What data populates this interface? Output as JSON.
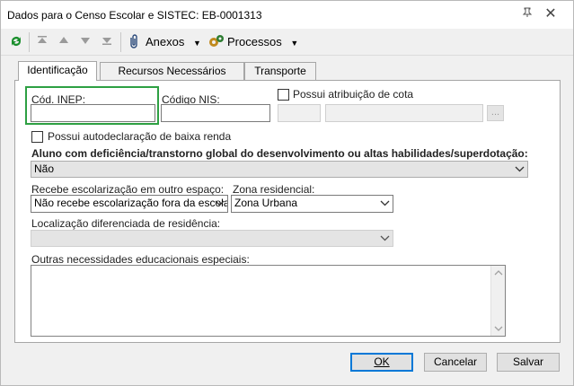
{
  "window": {
    "title": "Dados para o Censo Escolar e SISTEC: EB-0001313"
  },
  "toolbar": {
    "anexos": "Anexos",
    "processos": "Processos"
  },
  "tabs": [
    {
      "label": "Identificação"
    },
    {
      "label": "Recursos Necessários"
    },
    {
      "label": "Transporte"
    }
  ],
  "form": {
    "cod_inep_label": "Cód. INEP:",
    "codigo_nis_label": "Código NIS:",
    "cota_label": "Possui atribuição de cota",
    "autodeclaracao_label": "Possui autodeclaração de baixa renda",
    "deficiencia_label": "Aluno com deficiência/transtorno global do desenvolvimento ou altas habilidades/superdotação:",
    "deficiencia_value": "Não",
    "escolarizacao_label": "Recebe escolarização em outro espaço:",
    "escolarizacao_value": "Não recebe escolarização fora da escola",
    "zona_label": "Zona residencial:",
    "zona_value": "Zona Urbana",
    "localizacao_label": "Localização diferenciada de residência:",
    "outras_label": "Outras necessidades educacionais especiais:",
    "ellipsis": "..."
  },
  "buttons": {
    "ok": "OK",
    "cancelar": "Cancelar",
    "salvar": "Salvar"
  },
  "colors": {
    "highlight": "#2ea043",
    "default_border": "#0078d7"
  }
}
